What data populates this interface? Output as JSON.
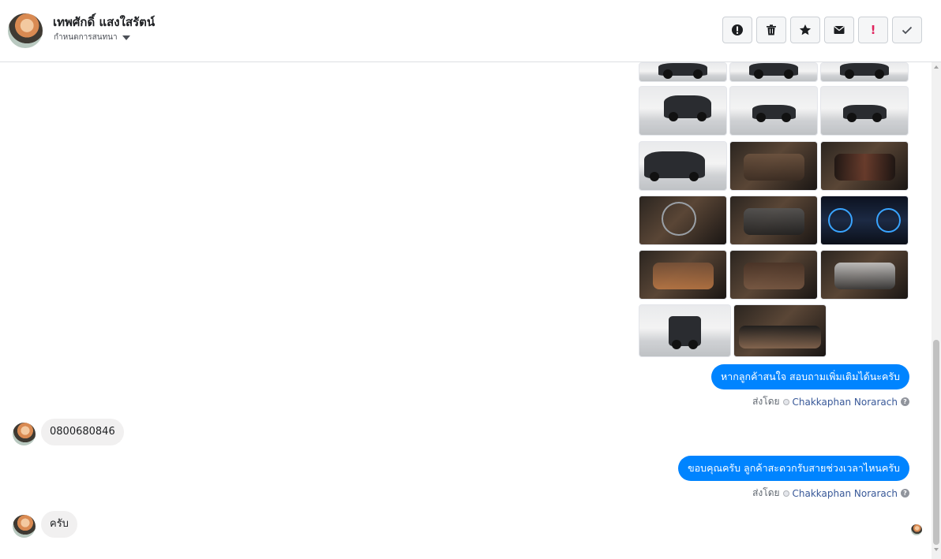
{
  "header": {
    "contact_name": "เทพศักดิ์ แสงใสรัตน์",
    "subtitle": "กำหนดการสนทนา"
  },
  "actions": [
    {
      "name": "mark-spam-button",
      "icon": "alert-circle-icon"
    },
    {
      "name": "delete-button",
      "icon": "trash-icon"
    },
    {
      "name": "star-button",
      "icon": "star-icon"
    },
    {
      "name": "mark-unread-button",
      "icon": "envelope-icon"
    },
    {
      "name": "follow-up-button",
      "icon": "exclamation-icon",
      "label": "!"
    },
    {
      "name": "done-button",
      "icon": "check-icon"
    }
  ],
  "messages": {
    "out1": "หากลูกค้าสนใจ สอบถามเพิ่มเติมได้นะครับ",
    "in1": "0800680846",
    "out2": "ขอบคุณครับ ลูกค้าสะดวกรับสายช่วงเวลาไหนครับ",
    "in2": "ครับ"
  },
  "sent_by": {
    "prefix": "ส่งโดย",
    "agent": "Chakkaphan Norarach"
  },
  "colors": {
    "outgoing_bubble": "#0084ff",
    "incoming_bubble": "#f1f0f0",
    "agent_link": "#385898",
    "follow_up_red": "#e0245e"
  }
}
